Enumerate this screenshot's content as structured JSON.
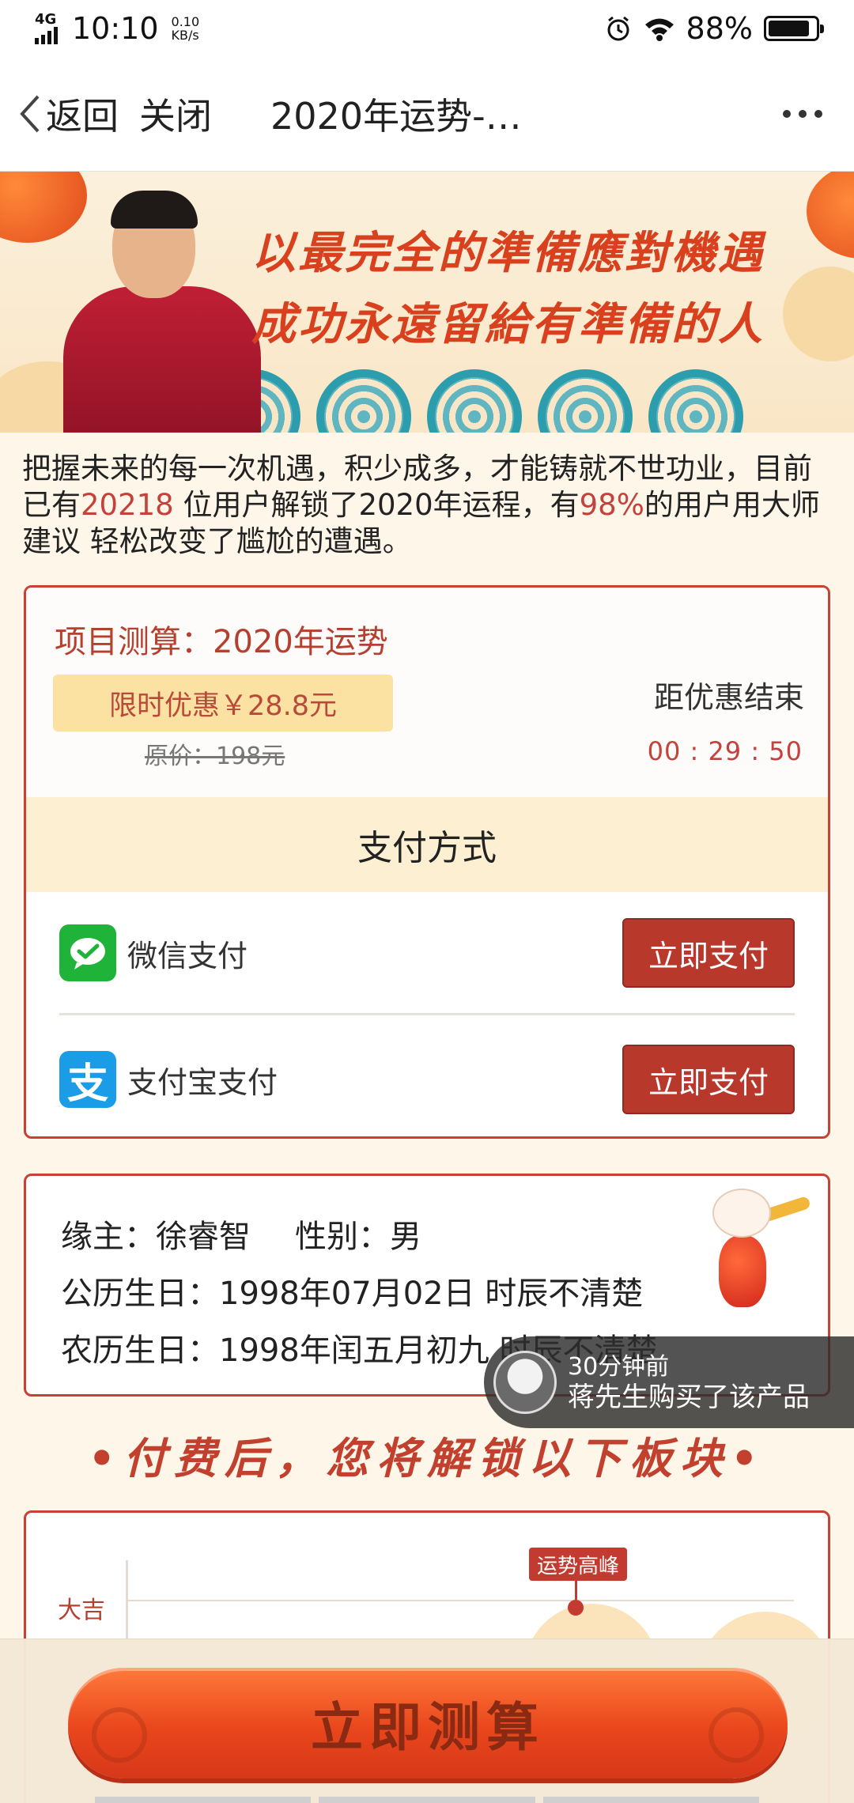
{
  "status_bar": {
    "network": "4G",
    "time": "10:10",
    "speed_value": "0.10",
    "speed_unit": "KB/s",
    "battery": "88%",
    "battery_level": 0.88,
    "icons": [
      "signal-icon",
      "alarm-icon",
      "wifi-icon",
      "battery-icon"
    ]
  },
  "nav": {
    "back_label": "返回",
    "close_label": "关闭",
    "title": "2020年运势-…"
  },
  "banner": {
    "slogan_line1": "以最完全的準備應對機遇",
    "slogan_line2": "成功永遠留給有準備的人"
  },
  "intro": {
    "part1": "把握未来的每一次机遇，积少成多，才能铸就不世功业，目前已有",
    "user_count": "20218",
    "part2": " 位用户解锁了2020年运程，有",
    "percent": "98%",
    "part3": "的用户用大师建议 轻松改变了尴尬的遭遇。"
  },
  "order": {
    "project": "项目测算：2020年运势",
    "promo_price": "限时优惠￥28.8元",
    "original_price": "原价：198元",
    "countdown_label": "距优惠结束",
    "countdown": "00 : 29 : 50",
    "payment_header": "支付方式",
    "methods": [
      {
        "label": "微信支付",
        "button": "立即支付",
        "icon": "wechat-pay-icon"
      },
      {
        "label": "支付宝支付",
        "button": "立即支付",
        "icon": "alipay-icon",
        "icon_glyph": "支"
      }
    ]
  },
  "profile": {
    "name_label": "缘主：",
    "name": "徐睿智",
    "gender_label": "性别：",
    "gender": "男",
    "solar_label": "公历生日：",
    "solar": "1998年07月02日 时辰不清楚",
    "lunar_label": "农历生日：",
    "lunar": "1998年闰五月初九 时辰不清楚"
  },
  "toast": {
    "time": "30分钟前",
    "message": "蒋先生购买了该产品"
  },
  "unlock_heading": "•付费后，您将解锁以下板块•",
  "chart_preview": {
    "y_label": "大吉",
    "peak_tag": "运势高峰"
  },
  "cta": {
    "label": "立即测算"
  },
  "colors": {
    "accent_red": "#b8382c",
    "highlight": "#c5413b",
    "promo_bg": "#fbe2a3",
    "wechat_green": "#1fb33a",
    "alipay_blue": "#1a9ce6"
  }
}
